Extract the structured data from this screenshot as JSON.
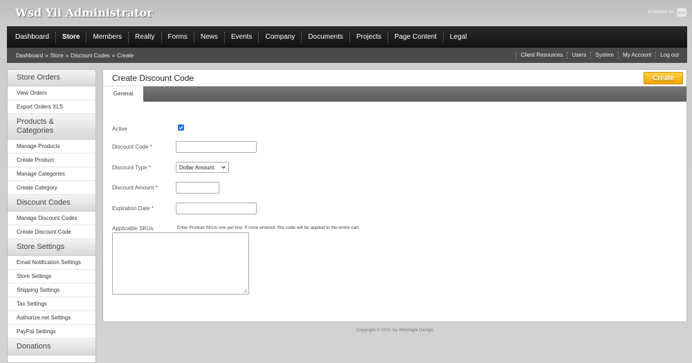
{
  "header": {
    "app_title": "Wsd Yii Administrator",
    "powered_by": "POWERED BY",
    "badge": "WSD"
  },
  "mainnav": {
    "items": [
      {
        "label": "Dashboard"
      },
      {
        "label": "Store",
        "active": true
      },
      {
        "label": "Members"
      },
      {
        "label": "Realty"
      },
      {
        "label": "Forms"
      },
      {
        "label": "News"
      },
      {
        "label": "Events"
      },
      {
        "label": "Company"
      },
      {
        "label": "Documents"
      },
      {
        "label": "Projects"
      },
      {
        "label": "Page Content"
      },
      {
        "label": "Legal"
      }
    ]
  },
  "breadcrumb": {
    "items": [
      "Dashboard",
      "Store",
      "Discount Codes",
      "Create"
    ],
    "separator": "»"
  },
  "utility": {
    "items": [
      "Client Resources",
      "Users",
      "System",
      "My Account",
      "Log out"
    ]
  },
  "sidebar": {
    "sections": [
      {
        "title": "Store Orders",
        "items": [
          "View Orders",
          "Export Orders XLS"
        ]
      },
      {
        "title": "Products & Categories",
        "items": [
          "Manage Products",
          "Create Product",
          "Manage Categories",
          "Create Category"
        ]
      },
      {
        "title": "Discount Codes",
        "items": [
          "Manage Discount Codes",
          "Create Discount Code"
        ]
      },
      {
        "title": "Store Settings",
        "items": [
          "Email Notification Settings",
          "Store Settings",
          "Shipping Settings",
          "Tax Settings",
          "Authorize.net Settings",
          "PayPal Settings"
        ]
      },
      {
        "title": "Donations",
        "items": []
      }
    ]
  },
  "panel": {
    "title": "Create Discount Code",
    "create_label": "Create",
    "tab_label": "General"
  },
  "form": {
    "active_label": "Active",
    "active_checked": true,
    "code_label": "Discount Code *",
    "code_value": "",
    "type_label": "Discount Type *",
    "type_selected": "Dollar Amount",
    "amount_label": "Discount Amount *",
    "amount_value": "",
    "expiration_label": "Expiration Date *",
    "expiration_value": "",
    "skus_label": "Applicable SKUs",
    "skus_hint": "Enter Product SKUs one per line. If none entered, this code will be applied to the entire cart."
  },
  "footer": {
    "copyright": "Copyright © 2021 by WebSight Design"
  },
  "colors": {
    "accent": "#f0a500",
    "nav_bg": "#1a1a1a",
    "checkbox": "#1a73e8"
  }
}
